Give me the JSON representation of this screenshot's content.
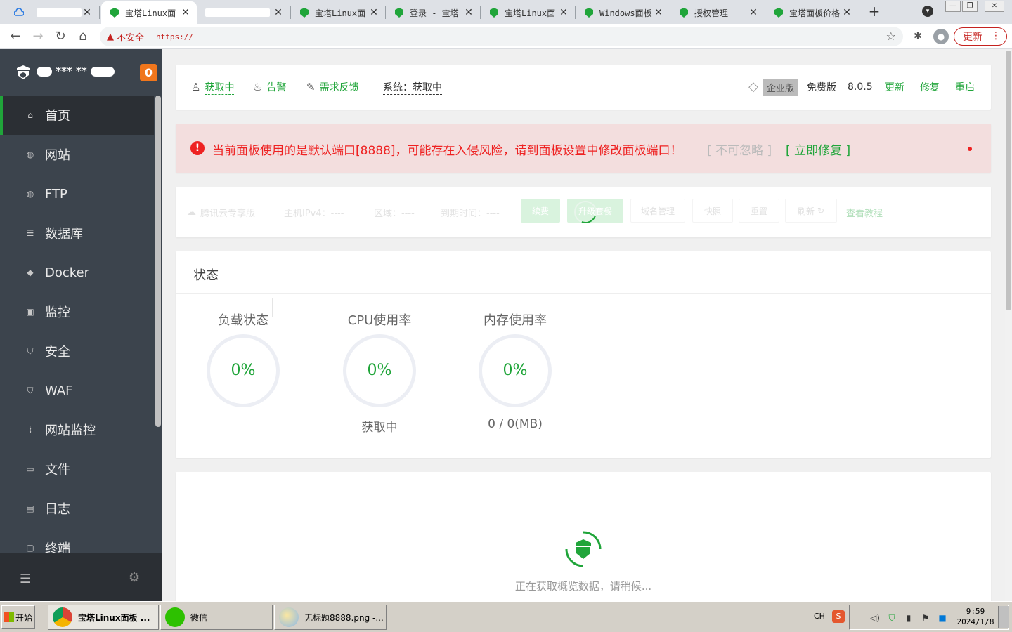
{
  "browser": {
    "tabs": [
      {
        "title": "",
        "redacted": true
      },
      {
        "title": "宝塔Linux面",
        "active": true
      },
      {
        "title": "",
        "redacted": true
      },
      {
        "title": "宝塔Linux面"
      },
      {
        "title": "登录 - 宝塔"
      },
      {
        "title": "宝塔Linux面"
      },
      {
        "title": "Windows面板"
      },
      {
        "title": "授权管理"
      },
      {
        "title": "宝塔面板价格"
      }
    ],
    "tab_close": "✕",
    "new_tab": "+",
    "security_text": "不安全",
    "url": "https://",
    "update_label": "更新",
    "colors": {
      "accent": "#20a53a",
      "danger": "#e22222",
      "sidebar_bg": "#3c444d"
    }
  },
  "sidebar": {
    "ip_text": "*** **",
    "badge": "0",
    "items": [
      {
        "label": "首页",
        "icon": "home-icon",
        "active": true
      },
      {
        "label": "网站",
        "icon": "globe-icon"
      },
      {
        "label": "FTP",
        "icon": "globe-icon"
      },
      {
        "label": "数据库",
        "icon": "database-icon"
      },
      {
        "label": "Docker",
        "icon": "docker-icon"
      },
      {
        "label": "监控",
        "icon": "monitor-icon"
      },
      {
        "label": "安全",
        "icon": "shield-icon"
      },
      {
        "label": "WAF",
        "icon": "waf-shield-icon"
      },
      {
        "label": "网站监控",
        "icon": "chart-icon"
      },
      {
        "label": "文件",
        "icon": "folder-icon"
      },
      {
        "label": "日志",
        "icon": "log-icon"
      },
      {
        "label": "终端",
        "icon": "terminal-icon"
      }
    ]
  },
  "topbar": {
    "user": "获取中",
    "alarm": "告警",
    "feedback": "需求反馈",
    "system": "系统：获取中",
    "enterprise": "企业版",
    "edition": "免费版",
    "version": "8.0.5",
    "update": "更新",
    "repair": "修复",
    "restart": "重启"
  },
  "alert": {
    "icon": "!",
    "message": "当前面板使用的是默认端口[8888]，可能存在入侵风险，请到面板设置中修改面板端口！",
    "ignore": "[ 不可忽略 ]",
    "fix": "[ 立即修复 ]"
  },
  "cloud": {
    "brand": "腾讯云专享版",
    "ipv4": "主机IPv4：----",
    "region": "区域：----",
    "expire": "到期时间：----",
    "renew": "续费",
    "upgrade": "升级套餐",
    "domain": "域名管理",
    "snapshot": "快照",
    "reset": "重置",
    "refresh": "刷新",
    "tutorial": "查看教程"
  },
  "status": {
    "title": "状态",
    "gauges": [
      {
        "label": "负载状态",
        "value": "0%",
        "sub": ""
      },
      {
        "label": "CPU使用率",
        "value": "0%",
        "sub": "获取中"
      },
      {
        "label": "内存使用率",
        "value": "0%",
        "sub": "0 / 0(MB)"
      }
    ]
  },
  "overview": {
    "loading": "正在获取概览数据，请稍候..."
  },
  "taskbar": {
    "start": "开始",
    "tasks": [
      {
        "label": "宝塔Linux面板 ..."
      },
      {
        "label": "微信"
      },
      {
        "label": "无标题8888.png -..."
      }
    ],
    "lang": "CH",
    "ime": "S",
    "time": "9:59",
    "date": "2024/1/8"
  }
}
